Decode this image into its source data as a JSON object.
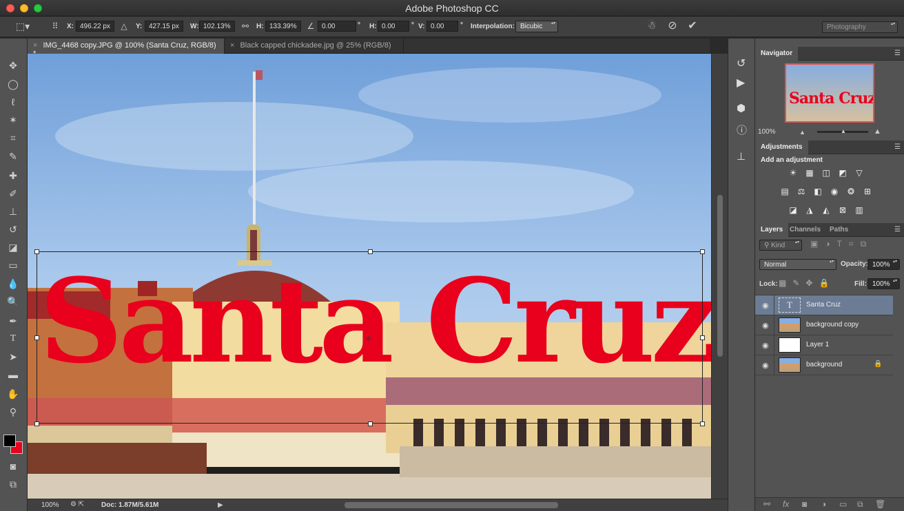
{
  "window": {
    "title": "Adobe Photoshop CC"
  },
  "options_bar": {
    "x_label": "X:",
    "x_value": "496.22 px",
    "y_label": "Y:",
    "y_value": "427.15 px",
    "w_label": "W:",
    "w_value": "102.13%",
    "h_label": "H:",
    "h_value": "133.39%",
    "rotate_value": "0.00",
    "degree": "°",
    "hskew_label": "H:",
    "hskew_value": "0.00",
    "vskew_label": "V:",
    "vskew_value": "0.00",
    "interp_label": "Interpolation:",
    "interp_value": "Bicubic",
    "workspace": "Photography"
  },
  "doc_tabs": [
    {
      "close": "×",
      "label": "IMG_4468 copy.JPG @ 100% (Santa Cruz, RGB/8) *"
    },
    {
      "close": "×",
      "label": "Black capped chickadee.jpg @ 25% (RGB/8)"
    }
  ],
  "canvas": {
    "text": "Santa Cruz",
    "text_color": "#e8001c"
  },
  "status_bar": {
    "zoom": "100%",
    "doc": "Doc: 1.87M/5.61M",
    "arrow": "▶"
  },
  "navigator": {
    "tab": "Navigator",
    "zoom": "100%",
    "thumb_text": "Santa Cruz"
  },
  "adjustments": {
    "tab": "Adjustments",
    "subtitle": "Add an adjustment"
  },
  "layers_panel": {
    "tabs": [
      "Layers",
      "Channels",
      "Paths"
    ],
    "kind": "Kind",
    "blend_mode": "Normal",
    "opacity_label": "Opacity:",
    "opacity_value": "100%",
    "lock_label": "Lock:",
    "fill_label": "Fill:",
    "fill_value": "100%",
    "layers": [
      {
        "name": "Santa Cruz",
        "selected": true
      },
      {
        "name": "background copy"
      },
      {
        "name": "Layer 1"
      },
      {
        "name": "background"
      }
    ]
  },
  "colors": {
    "foreground": "#000000",
    "background": "#e8001c",
    "selection": "#6b7c94"
  }
}
